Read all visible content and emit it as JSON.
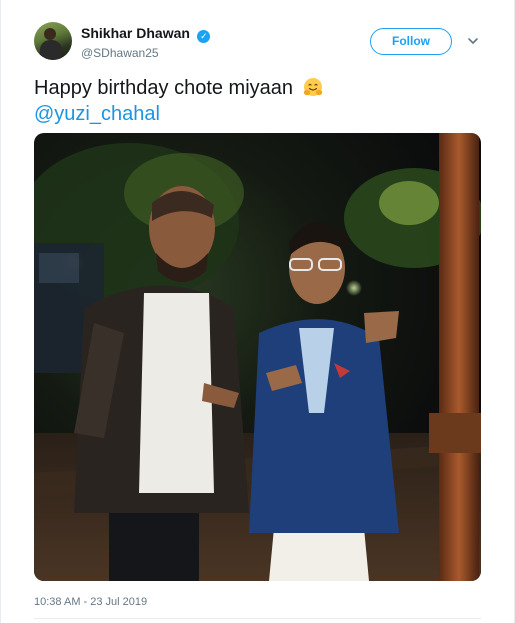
{
  "author": {
    "display_name": "Shikhar Dhawan",
    "handle": "@SDhawan25",
    "verified": true,
    "avatar_icon": "avatar-photo"
  },
  "follow_button": {
    "label": "Follow",
    "color": "#1da1f2"
  },
  "more_menu_icon": "chevron-down-icon",
  "tweet": {
    "text": "Happy birthday chote miyaan",
    "emoji": "hugging-face-icon",
    "mention": "@yuzi_chahal",
    "mention_color": "#1b95e0"
  },
  "media": {
    "type": "photo"
  },
  "timestamp": "10:38 AM - 23 Jul 2019"
}
